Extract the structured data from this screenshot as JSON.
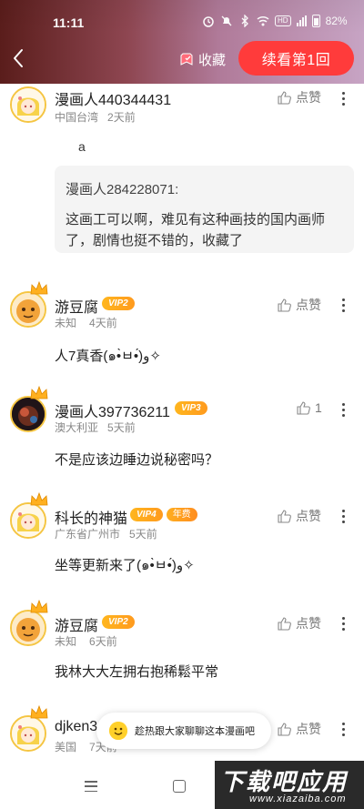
{
  "status_bar": {
    "time": "11:11",
    "battery": "82%",
    "network_badge": "HD"
  },
  "header": {
    "collect_label": "收藏",
    "continue_label": "续看第1回",
    "accent_color": "#ff3b3b"
  },
  "comments": [
    {
      "user": "漫画人440344431",
      "location": "中国台湾",
      "time": "2天前",
      "like": "点赞",
      "avatar": "anime-girl",
      "text": "a",
      "reply": {
        "user": "漫画人284228071:",
        "text_line1": "这画工可以啊，难见有这种画技的国内画师",
        "text_line2": "了，剧情也挺不错的，收藏了"
      }
    },
    {
      "user": "游豆腐",
      "badges": [
        "VIP2"
      ],
      "location": "未知",
      "time": "4天前",
      "like": "点赞",
      "avatar": "orange-face",
      "text": "人7真香(๑•̀ㅂ•́)و✧"
    },
    {
      "user": "漫画人397736211",
      "badges": [
        "VIP3"
      ],
      "location": "澳大利亚",
      "time": "5天前",
      "like": "1",
      "avatar": "dark-art",
      "text": "不是应该边睡边说秘密吗？"
    },
    {
      "user": "科长的神猫",
      "badges": [
        "VIP4",
        "年费"
      ],
      "location": "广东省广州市",
      "time": "5天前",
      "like": "点赞",
      "avatar": "anime-girl",
      "text": "坐等更新来了(๑•̀ㅂ•́)و✧"
    },
    {
      "user": "游豆腐",
      "badges": [
        "VIP2"
      ],
      "location": "未知",
      "time": "6天前",
      "like": "点赞",
      "avatar": "orange-face",
      "text": "我林大大左拥右抱稀鬆平常"
    },
    {
      "user": "djken3",
      "location": "美国",
      "time": "7天前",
      "like": "点赞",
      "avatar": "anime-girl"
    }
  ],
  "toast": {
    "text": "趁热跟大家聊聊这本漫画吧"
  },
  "watermark": {
    "title": "下载吧应用",
    "url": "www.xiazaiba.com"
  }
}
